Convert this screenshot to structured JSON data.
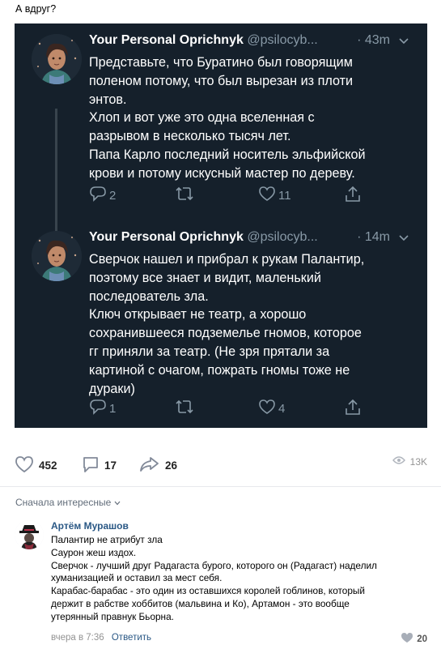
{
  "post": {
    "title": "А вдруг?"
  },
  "tweets": [
    {
      "name": "Your Personal Oprichnyk",
      "handle": "@psilocyb...",
      "time": "· 43m",
      "lines": [
        "Представьте, что Буратино был говорящим",
        "поленом потому, что был вырезан из плоти",
        "энтов.",
        "Хлоп и вот уже это одна вселенная с",
        "разрывом в несколько тысяч лет.",
        "Папа Карло последний носитель эльфийской",
        "крови и потому искусный мастер по дереву."
      ],
      "replies": "2",
      "retweets": "",
      "likes": "11"
    },
    {
      "name": "Your Personal Oprichnyk",
      "handle": "@psilocyb...",
      "time": "· 14m",
      "lines": [
        "Сверчок нашел и прибрал к рукам Палантир,",
        "поэтому все знает и видит, маленький",
        "последователь зла.",
        "Ключ открывает не театр, а хорошо",
        "сохранившееся подземелье гномов, которое",
        "гг приняли за театр. (Не зря прятали за",
        "картиной с очагом, пожрать гномы тоже не",
        "дураки)"
      ],
      "replies": "1",
      "retweets": "",
      "likes": "4"
    }
  ],
  "stats": {
    "likes": "452",
    "comments": "17",
    "shares": "26",
    "views": "13K"
  },
  "sort_label": "Сначала интересные",
  "comment": {
    "author": "Артём Мурашов",
    "lines": [
      "Палантир не атрибут зла",
      "Саурон жеш издох.",
      "Сверчок - лучший друг Радагаста бурого, которого он (Радагаст) наделил",
      "хуманизацией и оставил за мест себя.",
      "Карабас-барабас - это один из оставшихся королей гоблинов, который",
      "держит в рабстве хоббитов (мальвина и Ко), Артамон - это вообще",
      "утерянный правнук Бьорна."
    ],
    "time": "вчера в 7:36",
    "reply_label": "Ответить",
    "likes": "20"
  },
  "colors": {
    "card_bg": "#15202b",
    "muted": "#8899a6",
    "link": "#2a5885"
  },
  "icons": [
    "chevron-down-icon",
    "reply-icon",
    "retweet-icon",
    "heart-icon",
    "share-icon",
    "comment-icon",
    "share-arrow-icon",
    "eye-icon"
  ]
}
